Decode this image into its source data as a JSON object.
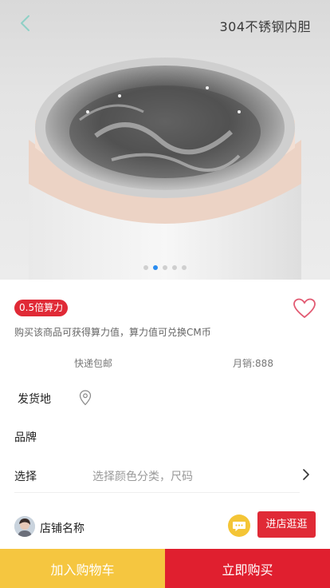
{
  "hero": {
    "caption": "304不锈钢内胆",
    "image_alt": "thermos inner stainless steel liner photo",
    "carousel_total": 5,
    "carousel_active": 2
  },
  "product": {
    "badge": "0.5倍算力",
    "hint": "购买该商品可获得算力值，算力值可兑换CM币",
    "shipping": "快递包邮",
    "sales": "月销:888"
  },
  "options": {
    "origin_label": "发货地",
    "brand_label": "品牌",
    "select_label": "选择",
    "select_value": "选择颜色分类，尺码"
  },
  "shop": {
    "name": "店铺名称",
    "visit_label": "进店逛逛"
  },
  "footer": {
    "cart_label": "加入购物车",
    "buy_label": "立即购买"
  },
  "colors": {
    "accent_red": "#e02a36",
    "accent_yellow": "#f5c640",
    "back_arrow": "#8fd0c6"
  },
  "icons": [
    "back-arrow-icon",
    "heart-icon",
    "location-pin-icon",
    "chevron-right-icon",
    "chat-bubble-icon"
  ]
}
